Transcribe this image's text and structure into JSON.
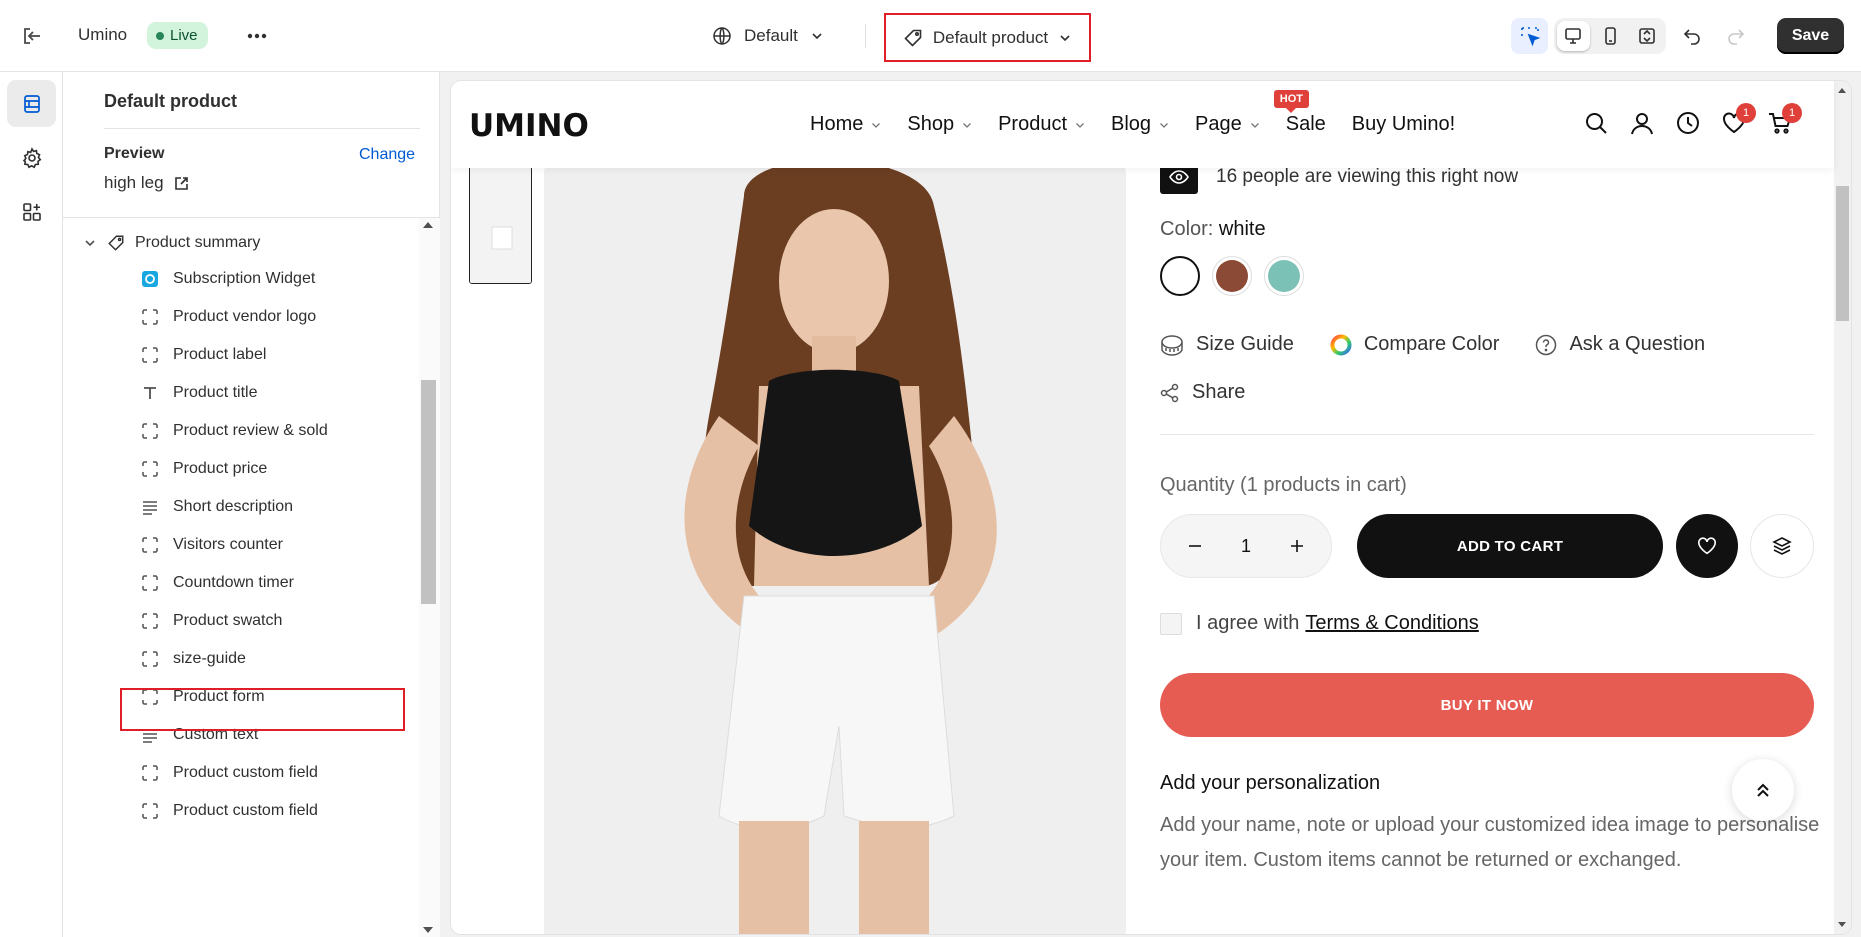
{
  "topbar": {
    "store_name": "Umino",
    "status": "Live",
    "theme": "Default",
    "template": "Default product",
    "save_label": "Save"
  },
  "sidebar": {
    "title": "Default product",
    "preview_label": "Preview",
    "change_label": "Change",
    "preview_value": "high leg",
    "group": "Product summary",
    "items": [
      {
        "label": "Subscription Widget",
        "icon": "subscription-app-icon"
      },
      {
        "label": "Product vendor logo",
        "icon": "block-icon"
      },
      {
        "label": "Product label",
        "icon": "block-icon"
      },
      {
        "label": "Product title",
        "icon": "text-icon"
      },
      {
        "label": "Product review & sold",
        "icon": "block-icon"
      },
      {
        "label": "Product price",
        "icon": "block-icon"
      },
      {
        "label": "Short description",
        "icon": "paragraph-icon"
      },
      {
        "label": "Visitors counter",
        "icon": "block-icon"
      },
      {
        "label": "Countdown timer",
        "icon": "block-icon"
      },
      {
        "label": "Product swatch",
        "icon": "block-icon"
      },
      {
        "label": "size-guide",
        "icon": "block-icon"
      },
      {
        "label": "Product form",
        "icon": "block-icon"
      },
      {
        "label": "Custom text",
        "icon": "paragraph-icon"
      },
      {
        "label": "Product custom field",
        "icon": "block-icon"
      },
      {
        "label": "Product custom field",
        "icon": "block-icon"
      }
    ]
  },
  "preview": {
    "logo": "UMINO",
    "nav": [
      {
        "label": "Home",
        "dropdown": true
      },
      {
        "label": "Shop",
        "dropdown": true
      },
      {
        "label": "Product",
        "dropdown": true
      },
      {
        "label": "Blog",
        "dropdown": true
      },
      {
        "label": "Page",
        "dropdown": true
      },
      {
        "label": "Sale",
        "dropdown": false,
        "badge": "HOT"
      },
      {
        "label": "Buy Umino!",
        "dropdown": false
      }
    ],
    "wishlist_count": "1",
    "cart_count": "1",
    "viewing_text": "16 people are viewing this right now",
    "color_label": "Color:",
    "color_value": "white",
    "swatches": [
      "#ffffff",
      "#8a4a36",
      "#7cc1b6"
    ],
    "size_guide": "Size Guide",
    "compare_color": "Compare Color",
    "ask_question": "Ask a Question",
    "share": "Share",
    "quantity_label": "Quantity (1 products in cart)",
    "quantity_value": "1",
    "add_to_cart": "ADD TO CART",
    "agree_prefix": "I agree with",
    "agree_link": "Terms & Conditions",
    "buy_now": "BUY IT NOW",
    "personalization_title": "Add your personalization",
    "personalization_text": "Add your name, note or upload your customized idea image to personalise your item. Custom items cannot be returned or exchanged."
  },
  "colors": {
    "accent": "#005bd3",
    "highlight": "#e01e26",
    "buy_now": "#e65b52",
    "live_badge_bg": "#d3f4dc"
  }
}
